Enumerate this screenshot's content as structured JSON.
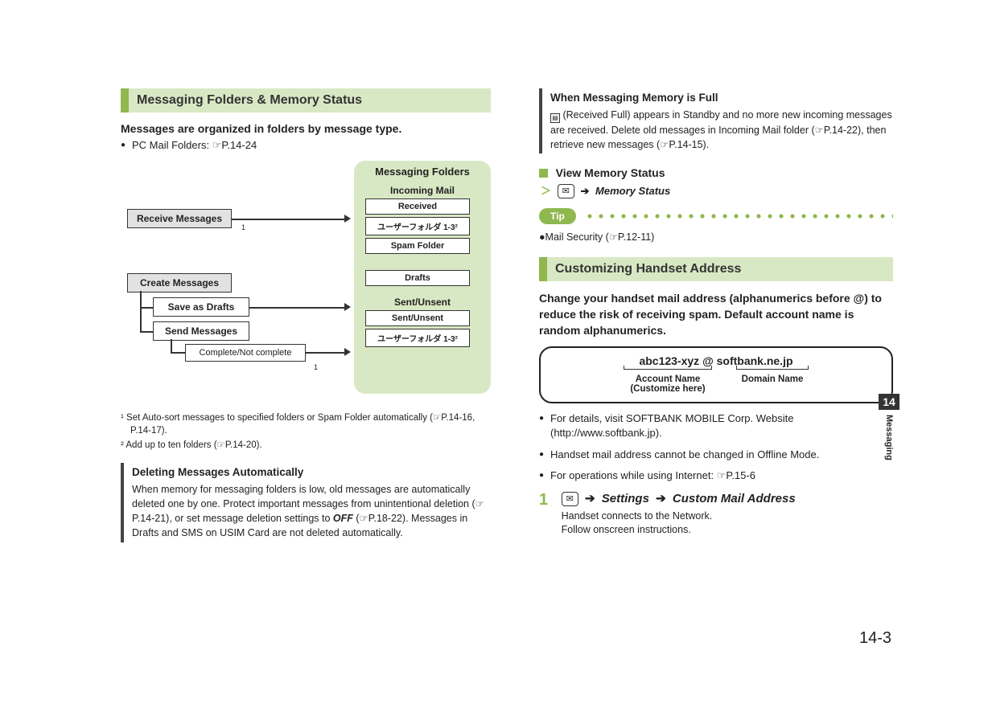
{
  "left": {
    "section_title": "Messaging Folders & Memory Status",
    "lead": "Messages are organized in folders by message type.",
    "pc_mail": "PC Mail Folders: ☞P.14-24",
    "diagram": {
      "group_title": "Messaging Folders",
      "receive": "Receive Messages",
      "incoming_mail_header": "Incoming Mail",
      "received": "Received",
      "user_folder_1": "ユーザーフォルダ 1-3²",
      "spam": "Spam Folder",
      "create": "Create Messages",
      "save_drafts": "Save as Drafts",
      "drafts": "Drafts",
      "send": "Send Messages",
      "complete": "Complete/Not complete",
      "sent_header": "Sent/Unsent",
      "sent_unsent": "Sent/Unsent",
      "user_folder_2": "ユーザーフォルダ 1-3²",
      "note1_marker": "1",
      "note2_marker": "1"
    },
    "footnote1": "¹ Set Auto-sort messages to specified folders or Spam Folder automatically (☞P.14-16, P.14-17).",
    "footnote2": "² Add up to ten folders (☞P.14-20).",
    "callout1_title": "Deleting Messages Automatically",
    "callout1_body_a": "When memory for messaging folders is low, old messages are automatically deleted one by one. Protect important messages from unintentional deletion (☞P.14-21), or set message deletion settings to ",
    "callout1_off": "OFF",
    "callout1_body_b": " (☞P.18-22). Messages in Drafts and SMS on USIM Card are not deleted automatically."
  },
  "right": {
    "callout2_title": "When Messaging Memory is Full",
    "callout2_body": " (Received Full) appears in Standby and no more new incoming messages are received. Delete old messages in Incoming Mail folder (☞P.14-22), then retrieve new messages (☞P.14-15).",
    "view_memory": "View Memory Status",
    "memory_status": "Memory Status",
    "tip_label": "Tip",
    "tip_item": "●Mail Security (☞P.12-11)",
    "section_title": "Customizing Handset Address",
    "lead": "Change your handset mail address (alphanumerics before @) to reduce the risk of receiving spam. Default account name is random alphanumerics.",
    "addr_example": "abc123-xyz @ softbank.ne.jp",
    "account_name": "Account Name",
    "customize_here": "(Customize here)",
    "domain_name": "Domain Name",
    "bullet_details": "For details, visit SOFTBANK MOBILE Corp. Website (http://www.softbank.jp).",
    "bullet_offline": "Handset mail address cannot be changed in Offline Mode.",
    "bullet_internet": "For operations while using Internet: ☞P.15-6",
    "step_num": "1",
    "step_settings": "Settings",
    "step_custom": "Custom Mail Address",
    "step_sub1": "Handset connects to the Network.",
    "step_sub2": "Follow onscreen instructions."
  },
  "side": {
    "tab_num": "14",
    "tab_label": "Messaging",
    "page_num": "14-3"
  }
}
